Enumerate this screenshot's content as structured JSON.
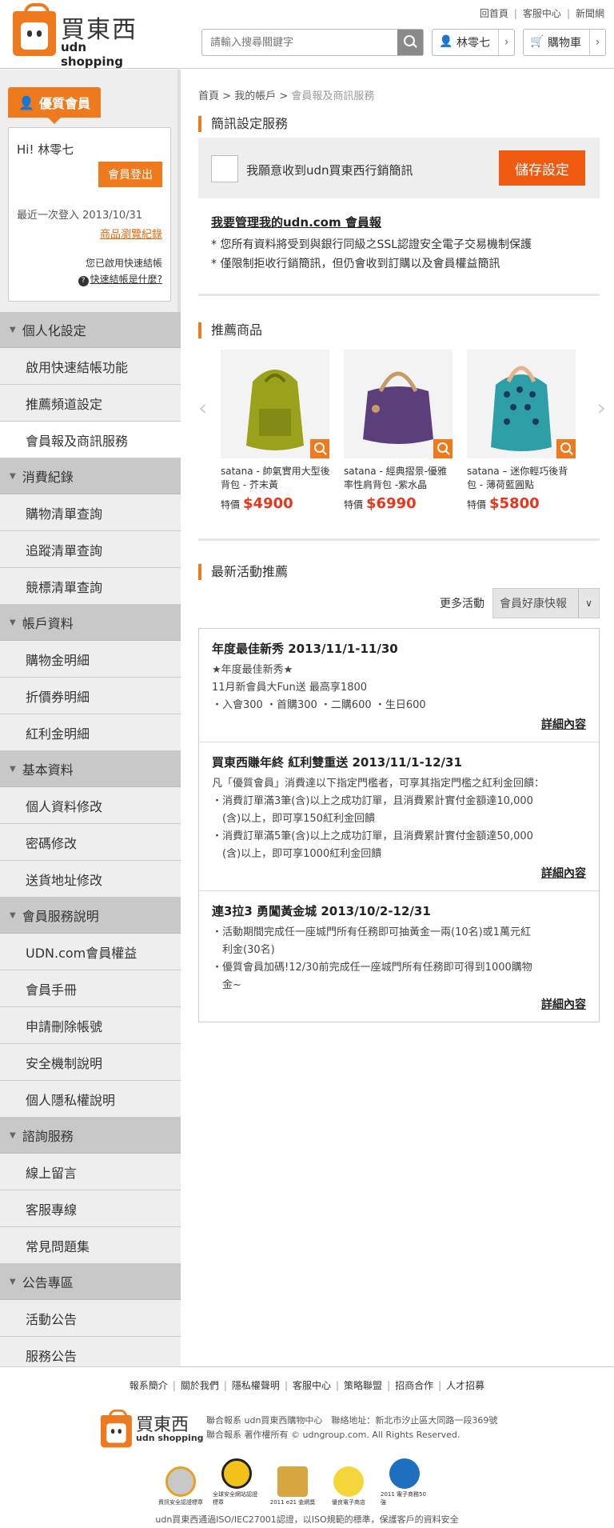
{
  "header": {
    "logo_cn": "買東西",
    "logo_en": "udn shopping",
    "toplinks": [
      "回首頁",
      "客服中心",
      "新聞網"
    ],
    "search_placeholder": "請輸入搜尋關鍵字",
    "user_name": "林零七",
    "cart_label": "購物車"
  },
  "sidebar": {
    "member_tab": "優質會員",
    "greeting": "Hi! 林零七",
    "logout": "會員登出",
    "last_login": "最近一次登入 2013/10/31",
    "history_link": "商品瀏覽紀錄",
    "quickpay_status": "您已啟用快速結帳",
    "quickpay_what": "快速結帳是什麼?",
    "sections": [
      {
        "title": "個人化設定",
        "items": [
          "啟用快速結帳功能",
          "推薦頻道設定",
          "會員報及商訊服務"
        ]
      },
      {
        "title": "消費紀錄",
        "items": [
          "購物清單查詢",
          "追蹤清單查詢",
          "競標清單查詢"
        ]
      },
      {
        "title": "帳戶資料",
        "items": [
          "購物金明細",
          "折價券明細",
          "紅利金明細"
        ]
      },
      {
        "title": "基本資料",
        "items": [
          "個人資料修改",
          "密碼修改",
          "送貨地址修改"
        ]
      },
      {
        "title": "會員服務說明",
        "items": [
          "UDN.com會員權益",
          "會員手冊",
          "申請刪除帳號",
          "安全機制說明",
          "個人隱私權說明"
        ]
      },
      {
        "title": "諮詢服務",
        "items": [
          "線上留言",
          "客服專線",
          "常見問題集"
        ]
      },
      {
        "title": "公告專區",
        "items": [
          "活動公告",
          "服務公告"
        ]
      }
    ]
  },
  "breadcrumb": {
    "home": "首頁",
    "sep": ">",
    "account": "我的帳戶",
    "current": "會員報及商訊服務"
  },
  "subscription": {
    "title": "簡訊設定服務",
    "checkbox_label": "我願意收到udn買東西行銷簡訊",
    "save": "儲存設定",
    "manage_link": "我要管理我的udn.com 會員報",
    "notes": [
      "* 您所有資料將受到與銀行同級之SSL認證安全電子交易機制保護",
      "* 僅限制拒收行銷簡訊，但仍會收到訂購以及會員權益簡訊"
    ]
  },
  "recommend": {
    "title": "推薦商品",
    "products": [
      {
        "name": "satana - 帥氣實用大型後背包 - 芥末黃",
        "price_label": "特價",
        "price": "$4900",
        "color": "#9aa21c"
      },
      {
        "name": "satana - 經典摺景-優雅率性肩背包 -紫水晶",
        "price_label": "特價",
        "price": "$6990",
        "color": "#5a3f7a"
      },
      {
        "name": "satana – 迷你輕巧後背包 - 薄荷藍圓點",
        "price_label": "特價",
        "price": "$5800",
        "color": "#2e9fa6"
      }
    ]
  },
  "events": {
    "title": "最新活動推薦",
    "more_label": "更多活動",
    "select_value": "會員好康快報",
    "list": [
      {
        "title": "年度最佳新秀 2013/11/1-11/30",
        "lines": [
          "★年度最佳新秀★",
          "11月新會員大Fun送 最高享1800",
          "・入會300 ・首購300 ・二購600 ・生日600"
        ],
        "more": "詳細內容"
      },
      {
        "title": "買東西賺年終 紅利雙重送 2013/11/1-12/31",
        "lines": [
          "凡「優質會員」消費達以下指定門檻者，可享其指定門檻之紅利金回饋：",
          "・消費訂單滿3筆(含)以上之成功訂單，且消費累計實付金額達10,000",
          "　(含)以上，即可享150紅利金回饋",
          "・消費訂單滿5筆(含)以上之成功訂單，且消費累計實付金額達50,000",
          "　(含)以上，即可享1000紅利金回饋"
        ],
        "more": "詳細內容"
      },
      {
        "title": "連3拉3 勇闖黃金城 2013/10/2-12/31",
        "lines": [
          "・活動期間完成任一座城門所有任務即可抽黃金一兩(10名)或1萬元紅",
          "　利金(30名)",
          "・優質會員加碼!12/30前完成任一座城門所有任務即可得到1000購物",
          "　金~"
        ],
        "more": "詳細內容"
      }
    ]
  },
  "footer": {
    "links": [
      "報系簡介",
      "關於我們",
      "隱私權聲明",
      "客服中心",
      "策略聯盟",
      "招商合作",
      "人才招募"
    ],
    "logo_cn": "買東西",
    "logo_en": "udn shopping",
    "info_line1": "聯合報系 udn買東西購物中心　聯絡地址：新北市汐止區大同路一段369號",
    "info_line2": "聯合報系 著作權所有 © udngroup.com. All Rights Reserved.",
    "badges": [
      "資訊安全認證標章",
      "全球安全網站認證標章",
      "2011 e21 金網獎",
      "優良電子商店",
      "2011 電子商務50強"
    ],
    "copy": "udn買東西通過ISO/IEC27001認證，以ISO規範的標準，保護客戶的資料安全",
    "colors": {
      "accent": "#ef7a1e",
      "price": "#e8361b",
      "save_button": "#f05a10"
    }
  }
}
